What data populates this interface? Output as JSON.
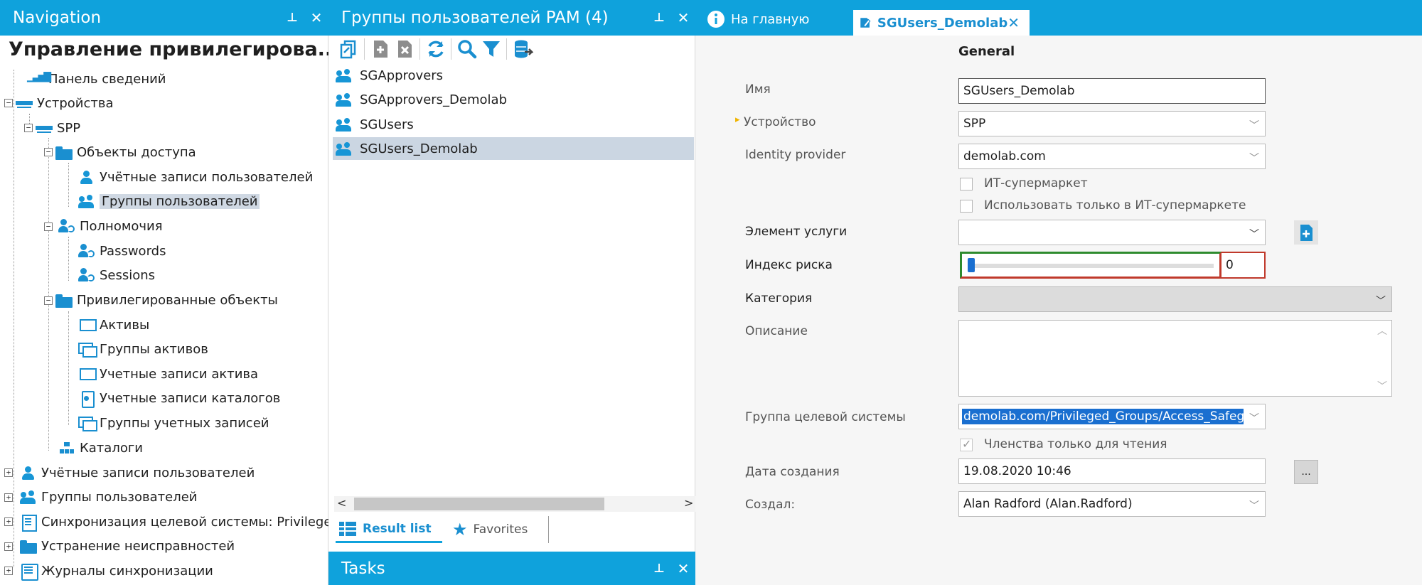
{
  "nav": {
    "header": "Navigation",
    "title": "Управление привилегирова...",
    "items": [
      {
        "label": "Панель сведений"
      },
      {
        "label": "Устройства"
      },
      {
        "label": "SPP"
      },
      {
        "label": "Объекты доступа"
      },
      {
        "label": "Учётные записи пользователей"
      },
      {
        "label": "Группы пользователей"
      },
      {
        "label": "Полномочия"
      },
      {
        "label": "Passwords"
      },
      {
        "label": "Sessions"
      },
      {
        "label": "Привилегированные объекты"
      },
      {
        "label": "Активы"
      },
      {
        "label": "Группы активов"
      },
      {
        "label": "Учетные записи актива"
      },
      {
        "label": "Учетные записи каталогов"
      },
      {
        "label": "Группы учетных записей"
      },
      {
        "label": "Каталоги"
      },
      {
        "label": "Учётные записи пользователей"
      },
      {
        "label": "Группы пользователей"
      },
      {
        "label": "Синхронизация целевой системы: Privileged"
      },
      {
        "label": "Устранение неисправностей"
      },
      {
        "label": "Журналы синхронизации"
      }
    ]
  },
  "middle": {
    "header": "Группы пользователей PAM (4)",
    "groups": [
      {
        "label": "SGApprovers"
      },
      {
        "label": "SGApprovers_Demolab"
      },
      {
        "label": "SGUsers"
      },
      {
        "label": "SGUsers_Demolab"
      }
    ],
    "bottom_tabs": {
      "result_list": "Result list",
      "favorites": "Favorites"
    },
    "tasks_header": "Tasks"
  },
  "right": {
    "tabs": {
      "home": "На главную",
      "current": "SGUsers_Demolab"
    },
    "section": "General",
    "fields": {
      "name_label": "Имя",
      "name_value": "SGUsers_Demolab",
      "device_label": "Устройство",
      "device_value": "SPP",
      "idp_label": "Identity provider",
      "idp_value": "demolab.com",
      "it_market_label": "ИТ-супермаркет",
      "it_market_only_label": "Использовать только в ИТ-супермаркете",
      "service_label": "Элемент услуги",
      "service_value": "",
      "risk_label": "Индекс риска",
      "risk_value": "0",
      "category_label": "Категория",
      "category_value": "",
      "description_label": "Описание",
      "description_value": "",
      "target_group_label": "Группа целевой системы",
      "target_group_value": "demolab.com/Privileged_Groups/Access_Safeg",
      "readonly_label": "Членства только для чтения",
      "created_label": "Дата создания",
      "created_value": "19.08.2020 10:46",
      "created_by_label": "Создал:",
      "created_by_value": "Alan Radford (Alan.Radford)",
      "dots": "..."
    },
    "risk_fraction": 0.0
  },
  "colors": {
    "accent": "#0fa2dc",
    "selection": "#cbd6e2",
    "icon": "#1a8fd0"
  },
  "icons": {
    "pin": "pin-icon",
    "close": "close-icon",
    "help": "help-icon"
  }
}
